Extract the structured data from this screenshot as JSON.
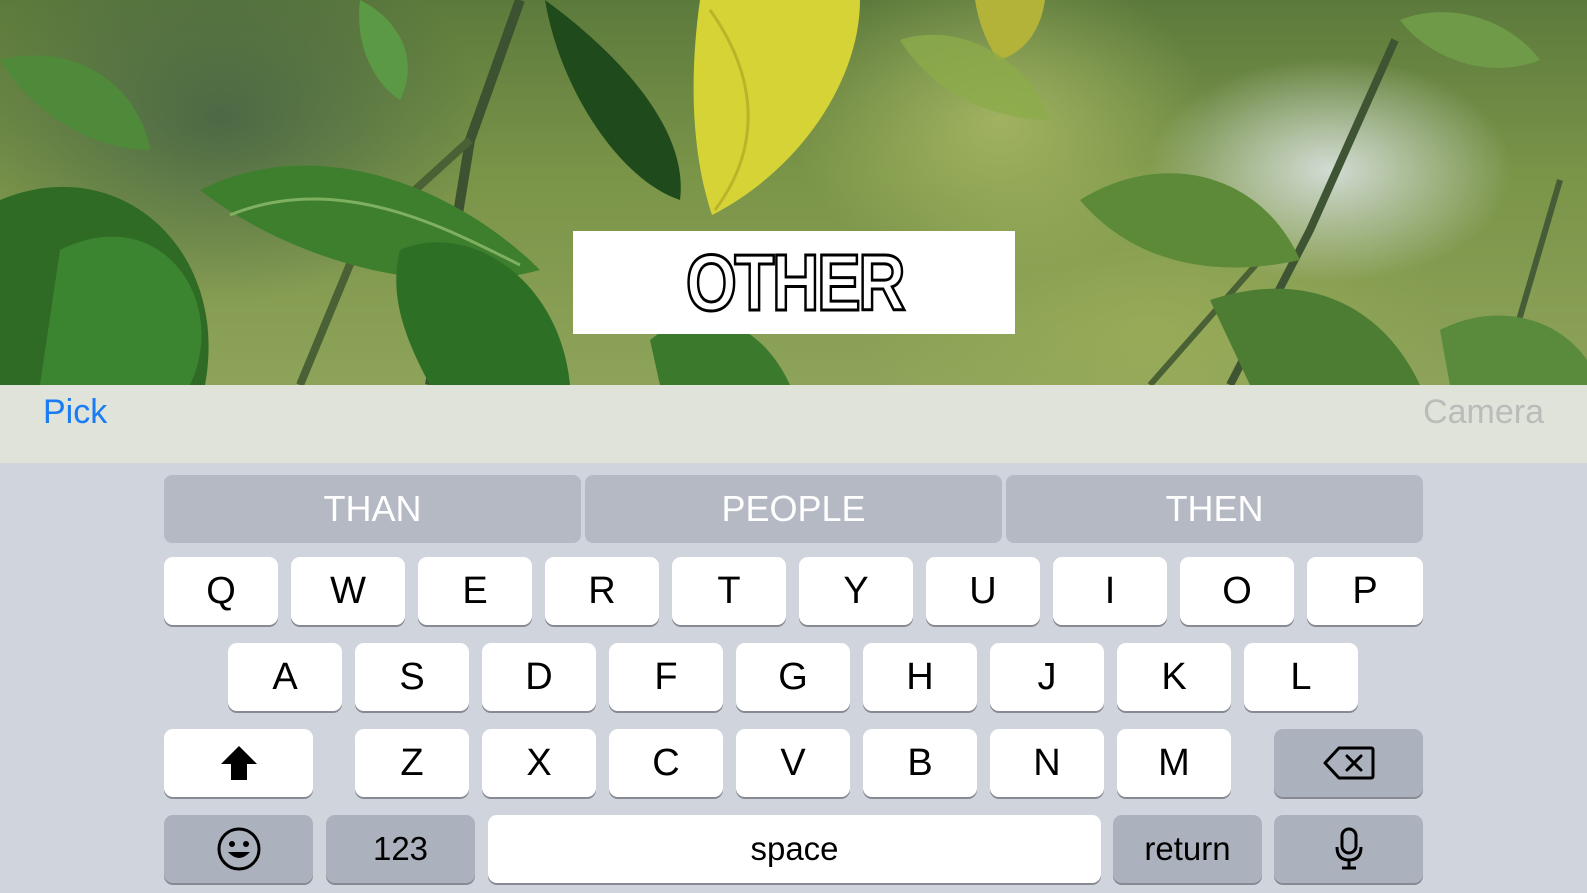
{
  "meme": {
    "caption": "OTHER"
  },
  "toolbar": {
    "pick_label": "Pick",
    "camera_label": "Camera"
  },
  "suggestions": [
    "THAN",
    "PEOPLE",
    "THEN"
  ],
  "keyboard": {
    "row1": [
      "Q",
      "W",
      "E",
      "R",
      "T",
      "Y",
      "U",
      "I",
      "O",
      "P"
    ],
    "row2": [
      "A",
      "S",
      "D",
      "F",
      "G",
      "H",
      "J",
      "K",
      "L"
    ],
    "row3": [
      "Z",
      "X",
      "C",
      "V",
      "B",
      "N",
      "M"
    ],
    "shift_icon": "shift-up-arrow-icon",
    "delete_icon": "backspace-icon",
    "emoji_icon": "smiley-face-icon",
    "mic_icon": "microphone-icon",
    "numbers_label": "123",
    "space_label": "space",
    "return_label": "return"
  },
  "colors": {
    "accent": "#1a7cf4",
    "keyboard_bg": "#d0d4dc",
    "key_bg": "#ffffff",
    "special_key_bg": "#acb2bd",
    "suggestion_bg": "#b4b9c3"
  }
}
